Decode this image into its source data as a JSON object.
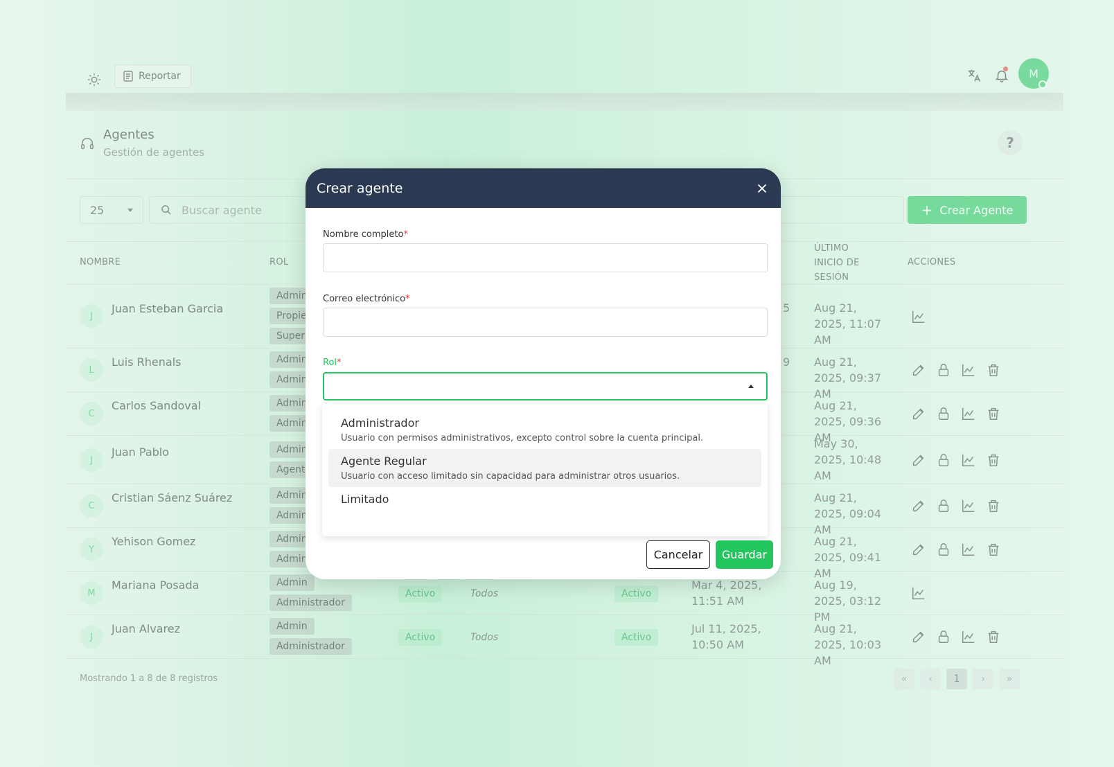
{
  "topbar": {
    "report_label": "Reportar",
    "user_initial": "M"
  },
  "section": {
    "title": "Agentes",
    "subtitle": "Gestión de agentes",
    "help_label": "?"
  },
  "toolbar": {
    "page_size": "25",
    "search_placeholder": "Buscar agente",
    "create_label": "Crear Agente"
  },
  "table": {
    "headers": {
      "name": "NOMBRE",
      "role": "ROL",
      "last_login_1": "ÚLTIMO",
      "last_login_2": "INICIO DE",
      "last_login_3": "SESIÓN",
      "actions": "ACCIONES"
    },
    "rows": [
      {
        "initial": "J",
        "name": "Juan Esteban Garcia",
        "roles": [
          "Admin",
          "Propiet",
          "Super A"
        ],
        "created": "5",
        "last_login": "Aug 21, 2025, 11:07 AM"
      },
      {
        "initial": "L",
        "name": "Luis Rhenals",
        "roles": [
          "Admin",
          "Admini"
        ],
        "created": "9",
        "last_login": "Aug 21, 2025, 09:37 AM"
      },
      {
        "initial": "C",
        "name": "Carlos Sandoval",
        "roles": [
          "Admin",
          "Admini"
        ],
        "created": "",
        "last_login": "Aug 21, 2025, 09:36 AM"
      },
      {
        "initial": "J",
        "name": "Juan Pablo",
        "roles": [
          "Admin",
          "Agente"
        ],
        "created": "",
        "last_login": "May 30, 2025, 10:48 AM"
      },
      {
        "initial": "C",
        "name": "Cristian Sáenz Suárez",
        "roles": [
          "Admin",
          "Admini"
        ],
        "created": "",
        "last_login": "Aug 21, 2025, 09:04 AM"
      },
      {
        "initial": "Y",
        "name": "Yehison Gomez",
        "roles": [
          "Admin",
          "Admini"
        ],
        "created": "",
        "last_login": "Aug 21, 2025, 09:41 AM"
      },
      {
        "initial": "M",
        "name": "Mariana Posada",
        "roles": [
          "Admin",
          "Administrador"
        ],
        "status": "Activo",
        "scope": "Todos",
        "status2": "Activo",
        "created": "Mar 4, 2025, 11:51 AM",
        "last_login": "Aug 19, 2025, 03:12 PM"
      },
      {
        "initial": "J",
        "name": "Juan Alvarez",
        "roles": [
          "Admin",
          "Administrador"
        ],
        "status": "Activo",
        "scope": "Todos",
        "status2": "Activo",
        "created": "Jul 11, 2025, 10:50 AM",
        "last_login": "Aug 21, 2025, 10:03 AM"
      }
    ],
    "footer": "Mostrando 1 a 8 de 8 registros",
    "pager": {
      "first": "«",
      "prev": "‹",
      "current": "1",
      "next": "›",
      "last": "»"
    }
  },
  "modal": {
    "title": "Crear agente",
    "name_label": "Nombre completo",
    "email_label": "Correo electrónico",
    "role_label": "Rol",
    "required_mark": "*",
    "options": [
      {
        "title": "Administrador",
        "desc": "Usuario con permisos administrativos, excepto control sobre la cuenta principal."
      },
      {
        "title": "Agente Regular",
        "desc": "Usuario con acceso limitado sin capacidad para administrar otros usuarios."
      },
      {
        "title": "Limitado",
        "desc": ""
      }
    ],
    "cancel_label": "Cancelar",
    "save_label": "Guardar"
  },
  "colors": {
    "accent": "#22c55e",
    "modal_header": "#2b3a52",
    "required": "#e53935"
  }
}
